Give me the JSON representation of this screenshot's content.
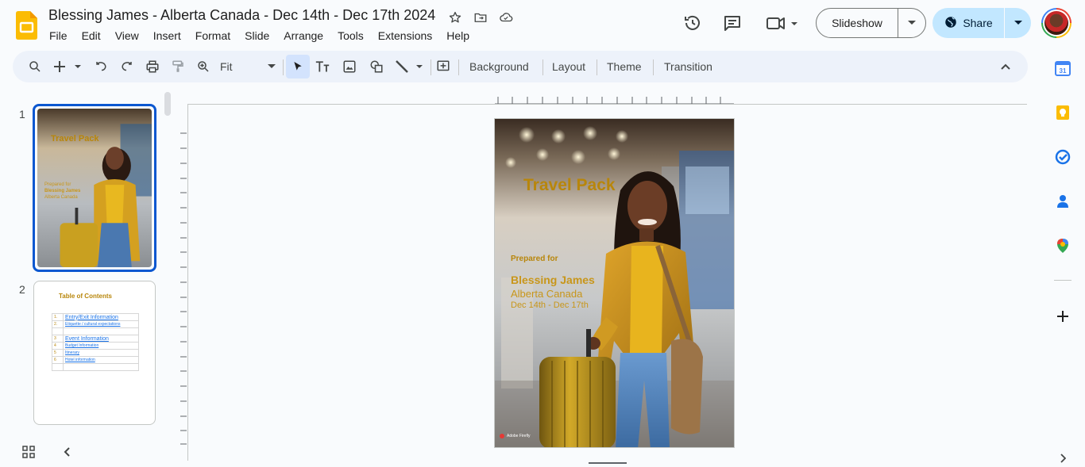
{
  "app": {
    "doc_title": "Blessing James - Alberta Canada - Dec 14th - Dec 17th 2024"
  },
  "menu": [
    "File",
    "Edit",
    "View",
    "Insert",
    "Format",
    "Slide",
    "Arrange",
    "Tools",
    "Extensions",
    "Help"
  ],
  "header": {
    "slideshow_label": "Slideshow",
    "share_label": "Share"
  },
  "toolbar": {
    "zoom_value": "Fit",
    "background_label": "Background",
    "layout_label": "Layout",
    "theme_label": "Theme",
    "transition_label": "Transition"
  },
  "filmstrip": {
    "slide1_number": "1",
    "slide2_number": "2",
    "thumb1_title": "Travel Pack",
    "thumb2_title": "Table of Contents",
    "toc_rows": [
      {
        "n": "1.",
        "label": "Entry/Exit Information"
      },
      {
        "n": "2.",
        "label": "Etiquette / cultural expectations"
      },
      {
        "n": "3",
        "label": "Event Information"
      },
      {
        "n": "4",
        "label": "Budget Information"
      },
      {
        "n": "5",
        "label": "Itinerary"
      },
      {
        "n": "6",
        "label": "Hotel information"
      }
    ]
  },
  "slide": {
    "title": "Travel Pack",
    "prepared_for": "Prepared for",
    "client_name": "Blessing James",
    "client_location": "Alberta Canada",
    "client_dates": "Dec 14th - Dec 17th",
    "watermark": "Adobe Firefly"
  },
  "colors": {
    "accent_gold": "#b8860b",
    "selection_blue": "#0b57d0",
    "share_bg": "#c2e7ff",
    "toolbar_bg": "#edf2fa"
  }
}
